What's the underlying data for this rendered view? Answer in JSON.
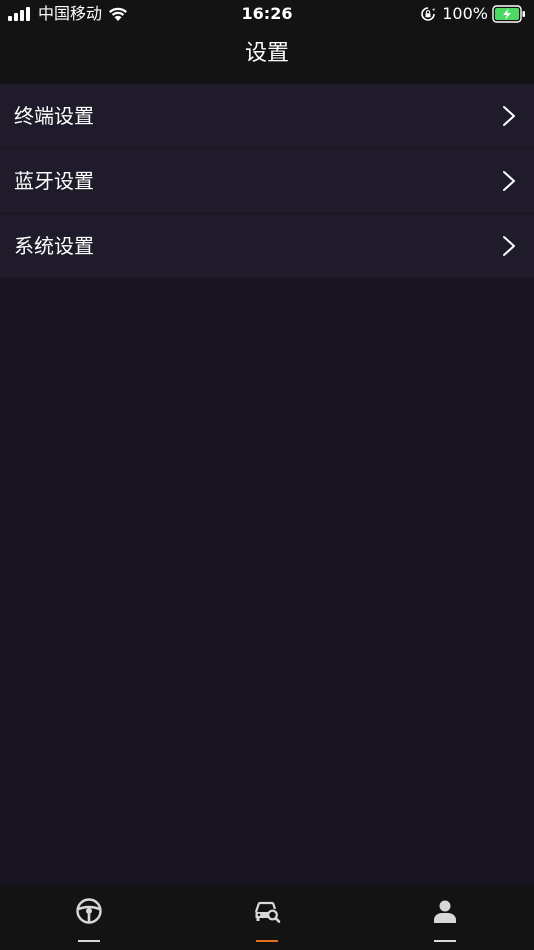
{
  "status_bar": {
    "carrier": "中国移动",
    "time": "16:26",
    "battery_percent": "100%",
    "icons": [
      "signal-icon",
      "wifi-icon",
      "rotation-lock-icon",
      "battery-charging-icon"
    ]
  },
  "nav": {
    "title": "设置"
  },
  "menu": {
    "items": [
      {
        "label": "终端设置",
        "icon": "chevron-right-icon"
      },
      {
        "label": "蓝牙设置",
        "icon": "chevron-right-icon"
      },
      {
        "label": "系统设置",
        "icon": "chevron-right-icon"
      }
    ]
  },
  "tabbar": {
    "tabs": [
      {
        "icon": "steering-wheel-icon",
        "active": false
      },
      {
        "icon": "car-search-icon",
        "active": true
      },
      {
        "icon": "person-icon",
        "active": false
      }
    ]
  },
  "colors": {
    "background": "#191422",
    "bar": "#141313",
    "row": "#201b2a",
    "accent": "#e56d1d",
    "battery": "#4cd964"
  }
}
